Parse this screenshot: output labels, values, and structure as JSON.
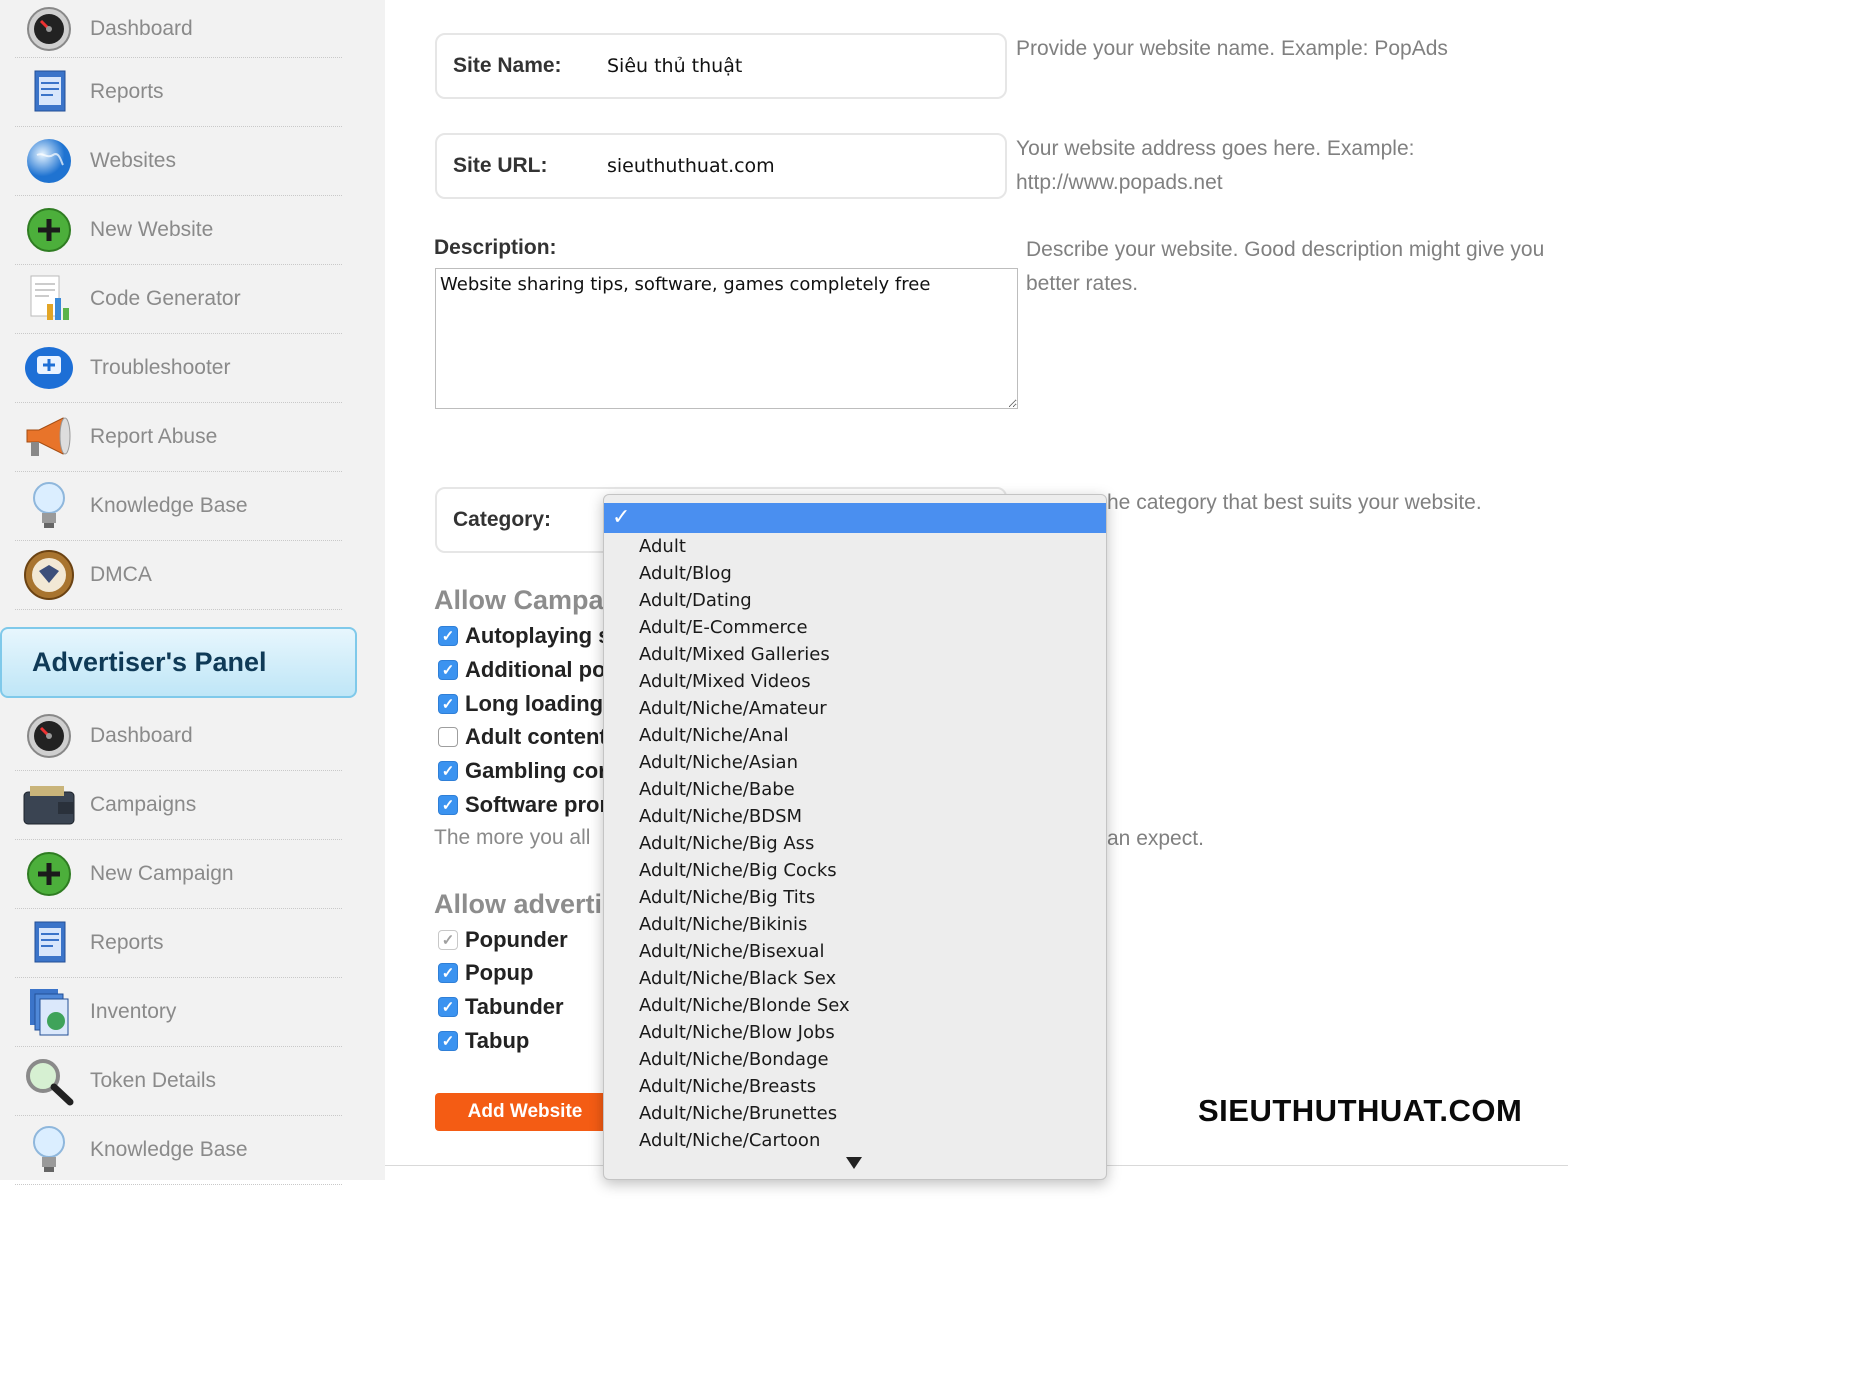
{
  "publisher_menu": [
    {
      "label": "Dashboard",
      "icon": "dashboard-icon"
    },
    {
      "label": "Reports",
      "icon": "reports-icon"
    },
    {
      "label": "Websites",
      "icon": "globe-icon"
    },
    {
      "label": "New Website",
      "icon": "plus-icon"
    },
    {
      "label": "Code Generator",
      "icon": "code-generator-icon"
    },
    {
      "label": "Troubleshooter",
      "icon": "troubleshooter-icon"
    },
    {
      "label": "Report Abuse",
      "icon": "megaphone-icon"
    },
    {
      "label": "Knowledge Base",
      "icon": "lightbulb-icon"
    },
    {
      "label": "DMCA",
      "icon": "seal-icon"
    }
  ],
  "advertiser_panel": {
    "title": "Advertiser's Panel",
    "menu": [
      {
        "label": "Dashboard",
        "icon": "dashboard-icon"
      },
      {
        "label": "Campaigns",
        "icon": "wallet-icon"
      },
      {
        "label": "New Campaign",
        "icon": "plus-icon"
      },
      {
        "label": "Reports",
        "icon": "reports-icon"
      },
      {
        "label": "Inventory",
        "icon": "inventory-icon"
      },
      {
        "label": "Token Details",
        "icon": "magnifier-icon"
      },
      {
        "label": "Knowledge Base",
        "icon": "lightbulb-icon"
      }
    ]
  },
  "form": {
    "site_name": {
      "label": "Site Name:",
      "value": "Siêu thủ thuật",
      "hint": "Provide your website name. Example: PopAds"
    },
    "site_url": {
      "label": "Site URL:",
      "value": "sieuthuthuat.com",
      "hint_line1": "Your website address goes here. Example:",
      "hint_line2": "http://www.popads.net"
    },
    "description": {
      "label": "Description:",
      "value": "Website sharing tips, software, games completely free",
      "hint_line1": "Describe your website. Good description might give you",
      "hint_line2": "better rates."
    },
    "category": {
      "label": "Category:",
      "hint": "he category that best suits your website.",
      "selected_mark": "✓"
    },
    "allow_campaigns": {
      "title": "Allow Campa",
      "options": [
        {
          "label": "Autoplaying s",
          "checked": true
        },
        {
          "label": "Additional po",
          "checked": true
        },
        {
          "label": "Long loading",
          "checked": true
        },
        {
          "label": "Adult content",
          "checked": false
        },
        {
          "label": "Gambling cor",
          "checked": true
        },
        {
          "label": "Software pror",
          "checked": true
        }
      ],
      "note_left": "The more you all",
      "note_right": "an expect."
    },
    "allow_advertising": {
      "title": "Allow adverti",
      "options": [
        {
          "label": "Popunder",
          "checked": true,
          "disabled": true
        },
        {
          "label": "Popup",
          "checked": true
        },
        {
          "label": "Tabunder",
          "checked": true
        },
        {
          "label": "Tabup",
          "checked": true
        }
      ]
    },
    "submit_label": "Add Website"
  },
  "category_options": [
    "Adult",
    "Adult/Blog",
    "Adult/Dating",
    "Adult/E-Commerce",
    "Adult/Mixed Galleries",
    "Adult/Mixed Videos",
    "Adult/Niche/Amateur",
    "Adult/Niche/Anal",
    "Adult/Niche/Asian",
    "Adult/Niche/Babe",
    "Adult/Niche/BDSM",
    "Adult/Niche/Big Ass",
    "Adult/Niche/Big Cocks",
    "Adult/Niche/Big Tits",
    "Adult/Niche/Bikinis",
    "Adult/Niche/Bisexual",
    "Adult/Niche/Black Sex",
    "Adult/Niche/Blonde Sex",
    "Adult/Niche/Blow Jobs",
    "Adult/Niche/Bondage",
    "Adult/Niche/Breasts",
    "Adult/Niche/Brunettes",
    "Adult/Niche/Cartoon"
  ],
  "watermark": "SIEUTHUTHUAT.COM",
  "colors": {
    "accent_button": "#f45c14",
    "selected_option": "#4a8ff0",
    "checkbox": "#3b93f0",
    "panel_header": "#bfe6f7"
  }
}
